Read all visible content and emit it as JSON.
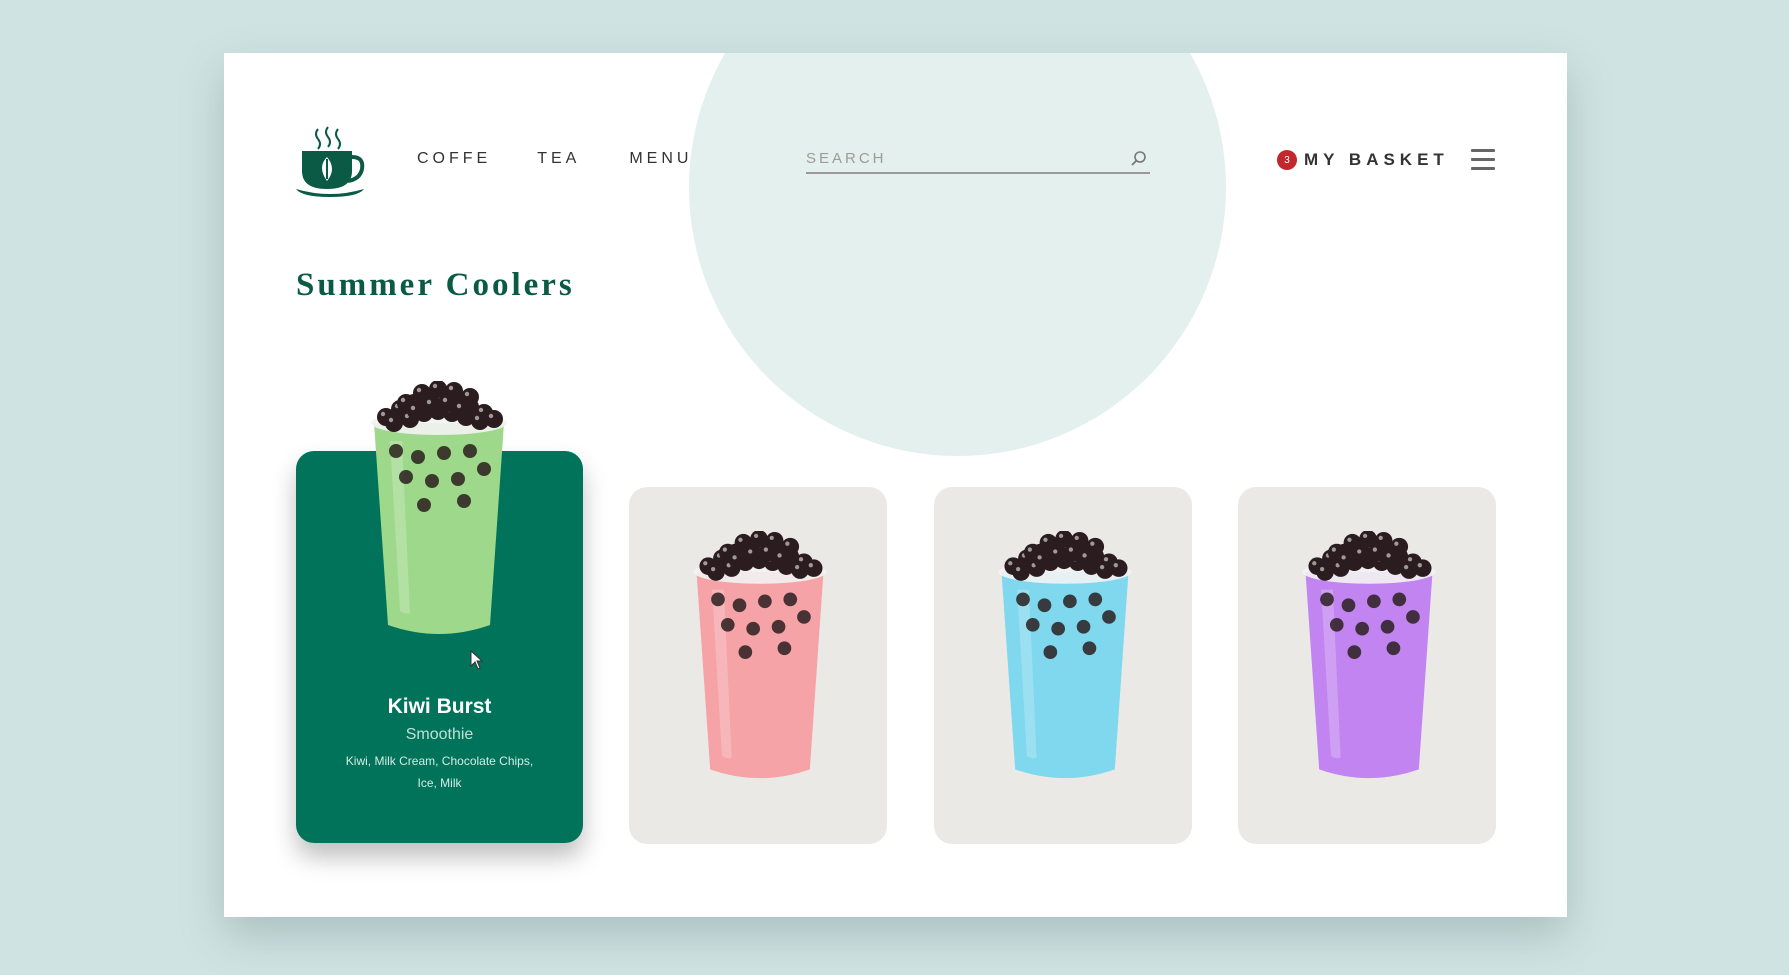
{
  "header": {
    "logo_icon": "coffee-cup-leaf-icon",
    "nav": [
      {
        "label": "COFFE"
      },
      {
        "label": "TEA"
      },
      {
        "label": "MENU"
      }
    ],
    "search": {
      "placeholder": "SEARCH",
      "value": "",
      "icon": "search-icon"
    },
    "basket": {
      "count": "3",
      "label": "MY BASKET"
    },
    "menu_icon": "hamburger-icon"
  },
  "main": {
    "title": "Summer Coolers",
    "products": [
      {
        "name": "Kiwi Burst",
        "type": "Smoothie",
        "ingredients": "Kiwi, Milk Cream, Chocolate Chips, Ice, Milk",
        "drink_color": "#9ed88a",
        "active": true
      },
      {
        "name": "",
        "type": "",
        "ingredients": "",
        "drink_color": "#f5a3a7",
        "active": false
      },
      {
        "name": "",
        "type": "",
        "ingredients": "",
        "drink_color": "#7fd8ee",
        "active": false
      },
      {
        "name": "",
        "type": "",
        "ingredients": "",
        "drink_color": "#c284f0",
        "active": false
      }
    ]
  },
  "colors": {
    "page_bg": "#cfe3e2",
    "accent": "#00735a",
    "title": "#0a5a45",
    "badge": "#c1272d",
    "card_grey": "#ebe9e6",
    "circle": "#e3f0ee"
  }
}
